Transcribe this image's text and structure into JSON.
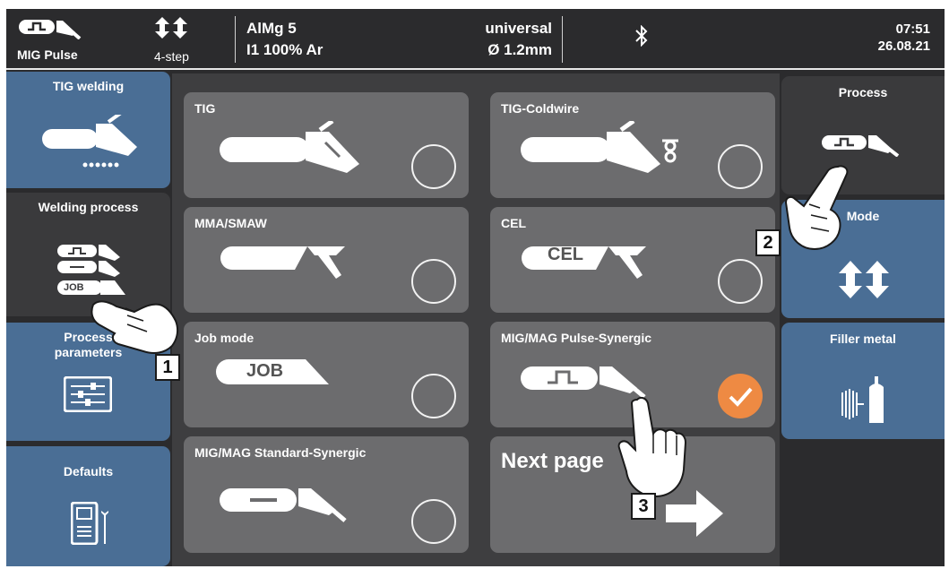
{
  "header": {
    "mode_label": "MIG Pulse",
    "trigger_label": "4-step",
    "material": "AlMg 5",
    "gas": "I1 100% Ar",
    "characteristic": "universal",
    "wire_diameter": "Ø 1.2mm",
    "time": "07:51",
    "date": "26.08.21"
  },
  "left_menu": [
    {
      "label": "TIG welding"
    },
    {
      "label": "Welding process"
    },
    {
      "label": "Process parameters"
    },
    {
      "label": "Defaults"
    }
  ],
  "right_menu": [
    {
      "label": "Process"
    },
    {
      "label": "Mode"
    },
    {
      "label": "Filler metal"
    }
  ],
  "dialog": {
    "tiles": [
      {
        "label": "TIG",
        "selected": false
      },
      {
        "label": "TIG-Coldwire",
        "selected": false
      },
      {
        "label": "MMA/SMAW",
        "selected": false
      },
      {
        "label": "CEL",
        "selected": false
      },
      {
        "label": "Job mode",
        "selected": false
      },
      {
        "label": "MIG/MAG Pulse-Synergic",
        "selected": true
      },
      {
        "label": "MIG/MAG Standard-Synergic",
        "selected": false
      }
    ],
    "next_page_label": "Next page",
    "cel_badge": "CEL",
    "job_badge": "JOB",
    "welding_process_job_badge": "JOB"
  },
  "callouts": [
    "1",
    "2",
    "3"
  ],
  "colors": {
    "panel_blue": "#4a6e95",
    "tile_grey": "#6c6c6e",
    "selected_orange": "#ee8a43",
    "background": "#2b2b2d"
  },
  "icons": [
    "mig-pulse-torch-icon",
    "updown-arrows-icon",
    "bluetooth-icon",
    "tig-torch-icon",
    "welding-process-stack-icon",
    "sliders-icon",
    "device-wrench-icon",
    "electrode-holder-icon",
    "coldwire-feed-icon",
    "wire-spool-bottle-icon",
    "arrow-right-icon",
    "pointing-hand-icon",
    "checkmark-icon"
  ]
}
